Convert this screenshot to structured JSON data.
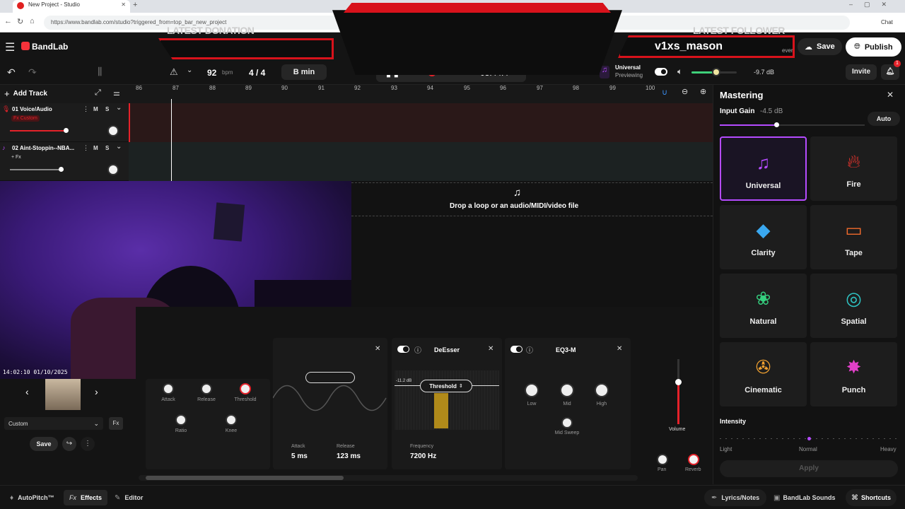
{
  "browser": {
    "tab_title": "New Project - Studio",
    "url": "https://www.bandlab.com/studio?triggered_from=top_bar_new_project",
    "chat_label": "Chat"
  },
  "overlay": {
    "donation_label": "LATEST DONATION",
    "follower_label": "LATEST FOLLOWER",
    "follower_name": "v1xs_mason",
    "partial_text": "ever"
  },
  "header": {
    "brand": "BandLab",
    "save_label": "Save",
    "publish_label": "Publish",
    "invite_label": "Invite",
    "notification_count": "1"
  },
  "transport": {
    "tempo": "92",
    "tempo_unit": "bpm",
    "time_signature": "4 / 4",
    "key": "B min",
    "time": "03:44.4",
    "master_preset_title": "Universal",
    "master_preset_subtitle": "Previewing",
    "volume_db": "-9.7 dB",
    "volume_level": 0.55
  },
  "tracks": {
    "add_label": "Add Track",
    "ruler": [
      "86",
      "87",
      "88",
      "89",
      "90",
      "91",
      "92",
      "93",
      "94",
      "95",
      "96",
      "97",
      "98",
      "99",
      "100"
    ],
    "items": [
      {
        "name": "01 Voice/Audio",
        "fx_badge": "Fx Custom",
        "mute": "M",
        "solo": "S"
      },
      {
        "name": "02 Aint-Stoppin--NBA...",
        "fx_badge": "+ Fx",
        "mute": "M",
        "solo": "S"
      }
    ],
    "drop_hint": "Drop a loop or an audio/MIDI/video file"
  },
  "webcam": {
    "timestamp": "14:02:10 01/10/2025"
  },
  "instrument": {
    "preset_value": "Custom",
    "save_label": "Save"
  },
  "effects": {
    "compressor": {
      "knobs": [
        "Attack",
        "Release",
        "Threshold",
        "Ratio",
        "Knee"
      ]
    },
    "gate": {
      "attack_label": "Attack",
      "attack_value": "5 ms",
      "release_label": "Release",
      "release_value": "123 ms"
    },
    "deesser": {
      "title": "DeEsser",
      "threshold_label": "Threshold",
      "threshold_value": "-11.2 dB",
      "frequency_label": "Frequency",
      "frequency_value": "7200 Hz"
    },
    "eq": {
      "title": "EQ3-M",
      "knobs": [
        "Low",
        "Mid",
        "High",
        "Mid Sweep"
      ]
    },
    "mixer": {
      "volume_label": "Volume",
      "pan_label": "Pan",
      "reverb_label": "Reverb"
    }
  },
  "mastering": {
    "title": "Mastering",
    "input_gain_label": "Input Gain",
    "input_gain_value": "-4.5 dB",
    "auto_label": "Auto",
    "presets": [
      {
        "label": "Universal",
        "icon": "music-notes-icon",
        "color": "#b54bff"
      },
      {
        "label": "Fire",
        "icon": "flame-icon",
        "color": "#e8342e"
      },
      {
        "label": "Clarity",
        "icon": "diamond-icon",
        "color": "#3aa8f0"
      },
      {
        "label": "Tape",
        "icon": "cassette-icon",
        "color": "#f06a2c"
      },
      {
        "label": "Natural",
        "icon": "lotus-icon",
        "color": "#35d07f"
      },
      {
        "label": "Spatial",
        "icon": "spiral-icon",
        "color": "#2ec4c4"
      },
      {
        "label": "Cinematic",
        "icon": "film-reel-icon",
        "color": "#f0a030"
      },
      {
        "label": "Punch",
        "icon": "burst-icon",
        "color": "#e040c8"
      }
    ],
    "intensity_label": "Intensity",
    "intensity_light": "Light",
    "intensity_normal": "Normal",
    "intensity_heavy": "Heavy",
    "intensity_level": 0.5,
    "apply_label": "Apply"
  },
  "bottom": {
    "autopitch": "AutoPitch™",
    "effects": "Effects",
    "editor": "Editor",
    "lyrics": "Lyrics/Notes",
    "sounds": "BandLab Sounds",
    "shortcuts": "Shortcuts"
  }
}
